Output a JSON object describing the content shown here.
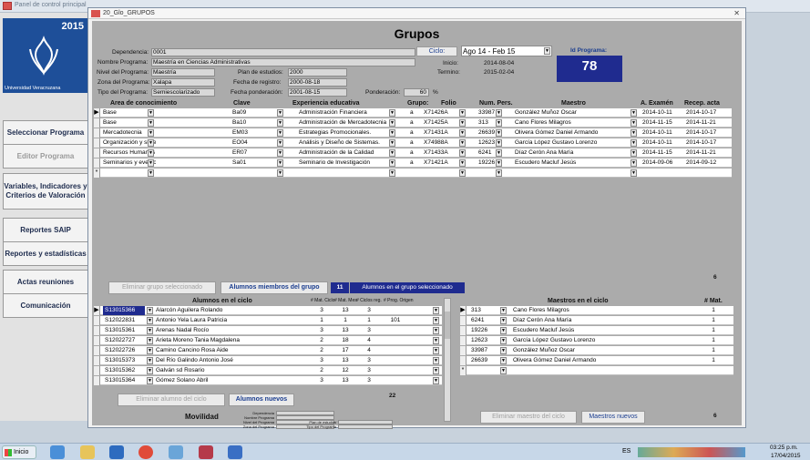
{
  "outer": {
    "title": "Panel de control principal"
  },
  "sidebar": {
    "year": "2015",
    "univ": "Universidad Veracruzana",
    "buttons": [
      "Seleccionar Programa",
      "Editor Programa",
      "Variables, Indicadores y Criterios de Valoración",
      "Reportes SAIP",
      "Reportes y estadísticas",
      "Actas reuniones",
      "Comunicación"
    ]
  },
  "window": {
    "title": "20_Glo_GRUPOS",
    "heading": "Grupos"
  },
  "info": {
    "dependencia_label": "Dependencia:",
    "dependencia": "0001",
    "nombre_label": "Nombre Programa:",
    "nombre": "Maestría en Ciencias Administrativas",
    "nivel_label": "Nivel del Programa:",
    "nivel": "Maestría",
    "zona_label": "Zona del Programa:",
    "zona": "Xalapa",
    "tipo_label": "Tipo del Programa:",
    "tipo": "Semiescolarizado",
    "plan_label": "Plan de estudios:",
    "plan": "2000",
    "registro_label": "Fecha de registro:",
    "registro": "2000-08-18",
    "ponderacion_label": "Fecha ponderación:",
    "ponderacion": "2001-08-15",
    "ponder_label": "Ponderación:",
    "ponder": "60",
    "pct": "%",
    "ciclo_label": "Ciclo:",
    "ciclo": "Ago 14 - Feb 15",
    "inicio_label": "Inicio:",
    "inicio": "2014-08-04",
    "termino_label": "Termino:",
    "termino": "2015-02-04",
    "idprog_label": "Id Programa:",
    "idprog": "78"
  },
  "groups": {
    "headers": [
      "Area de conocimiento",
      "Clave",
      "Experiencia educativa",
      "Grupo:",
      "Folio",
      "Num. Pers.",
      "Maestro",
      "A. Examén",
      "Recep. acta"
    ],
    "rows": [
      [
        "Base",
        "Ba09",
        "Administración Financiera",
        "a",
        "X71426A",
        "33987",
        "González Muñoz Oscar",
        "2014-10-11",
        "2014-10-17"
      ],
      [
        "Base",
        "Ba10",
        "Administración de Mercadotecnia",
        "a",
        "X71425A",
        "313",
        "Cano Flores Milagros",
        "2014-11-15",
        "2014-11-21"
      ],
      [
        "Mercadotecnia",
        "EM03",
        "Estrategias Promocionales.",
        "a",
        "X71431A",
        "26639",
        "Olivera Gómez Daniel  Armando",
        "2014-10-11",
        "2014-10-17"
      ],
      [
        "Organización y sistemas",
        "EO04",
        "Análisis y Diseño de Sistemas.",
        "a",
        "X74988A",
        "12623",
        "García López Gustavo Lorenzo",
        "2014-10-11",
        "2014-10-17"
      ],
      [
        "Recursos Humanos",
        "ER07",
        "Administración de la Calidad",
        "a",
        "X71433A",
        "6241",
        "Díaz Cerón Ana María",
        "2014-11-15",
        "2014-11-21"
      ],
      [
        "Seminarios y eventos acad",
        "Sa01",
        "Seminario de Investigación",
        "a",
        "X71421A",
        "19226",
        "Escudero Macluf Jesús",
        "2014-09-06",
        "2014-09-12"
      ]
    ],
    "new_row": "*"
  },
  "mid_toolbar": {
    "delete_group": "Eliminar grupo seleccionado",
    "members": "Alumnos miembros del grupo",
    "count": "11",
    "count_label": "Alumnos en el grupo seleccionado",
    "teachers_count": "6"
  },
  "students": {
    "title": "Alumnos en el ciclo",
    "headers": [
      "# Mat. Ciclo",
      "# Mat. Mes",
      "# Ciclos reg.",
      "# Prog. Origen"
    ],
    "rows": [
      [
        "S13015366",
        "Alarcón Aguilera Rolando",
        "3",
        "13",
        "3",
        ""
      ],
      [
        "S12022831",
        "Antonio Yela Laura Patricia",
        "1",
        "1",
        "1",
        "101"
      ],
      [
        "S13015361",
        "Arenas Nadal Rocío",
        "3",
        "13",
        "3",
        ""
      ],
      [
        "S12022727",
        "Arieta Moreno Tania Magdalena",
        "2",
        "18",
        "4",
        ""
      ],
      [
        "S12022726",
        "Camino Cancino Rosa Aide",
        "2",
        "17",
        "4",
        ""
      ],
      [
        "S13015373",
        "Del Río Galindo Antonio José",
        "3",
        "13",
        "3",
        ""
      ],
      [
        "S13015362",
        "Galván sd Rosario",
        "2",
        "12",
        "3",
        ""
      ],
      [
        "S13015364",
        "Gómez Solano Abril",
        "3",
        "13",
        "3",
        ""
      ]
    ],
    "delete": "Eliminar alumno del ciclo",
    "new": "Alumnos nuevos",
    "total": "22",
    "movilidad": "Movilidad",
    "mov_labels": [
      "Dependencia",
      "Nombre Programa",
      "Nivel del Programa",
      "Zona del Programa"
    ],
    "mov_labels2": [
      "Plan de estudios",
      "Tipo del Programa"
    ]
  },
  "teachers": {
    "title": "Maestros en el ciclo",
    "mat_header": "# Mat.",
    "rows": [
      [
        "313",
        "Cano Flores Milagros",
        "1"
      ],
      [
        "6241",
        "Díaz Cerón Ana María",
        "1"
      ],
      [
        "19226",
        "Escudero Macluf Jesús",
        "1"
      ],
      [
        "12623",
        "García López Gustavo Lorenzo",
        "1"
      ],
      [
        "33987",
        "González Muñoz Oscar",
        "1"
      ],
      [
        "26639",
        "Olivera Gómez Daniel  Armando",
        "1"
      ]
    ],
    "new_row": "*",
    "delete": "Eliminar maestro del ciclo",
    "new": "Maestros nuevos",
    "total": "6"
  },
  "taskbar": {
    "start": "Inicio",
    "lang": "ES",
    "time": "03:25 p.m.",
    "date": "17/04/2015"
  },
  "colors": {
    "navy": "#1f2b8f",
    "logo": "#1e4f99",
    "form_bg": "#ababab"
  }
}
